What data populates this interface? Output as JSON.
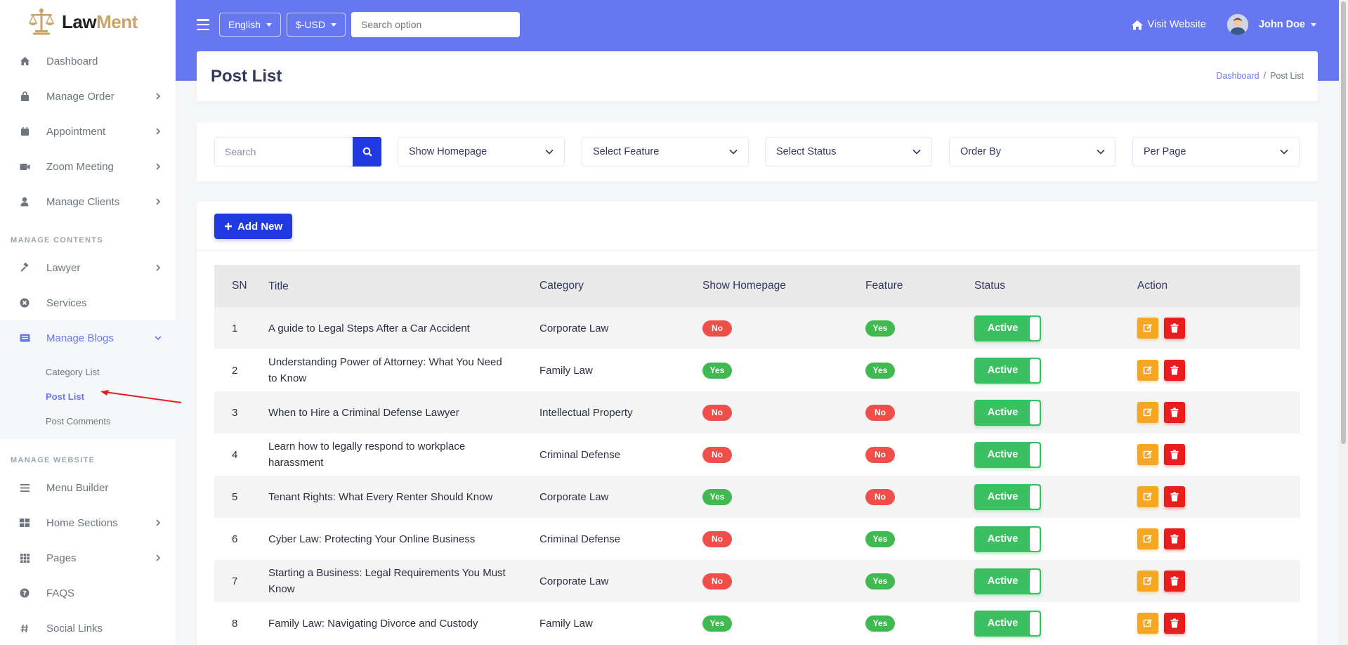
{
  "brand": {
    "name_part1": "Law",
    "name_part2": "Ment",
    "accent": "#c7a56a"
  },
  "colors": {
    "primary": "#6777ef",
    "button": "#2039e0",
    "yes": "#3fb950",
    "no": "#f04e4a",
    "active": "#3ac060",
    "edit": "#f5a623",
    "delete": "#ea1d1d"
  },
  "sidebar": {
    "items_top": [
      {
        "label": "Dashboard",
        "icon": "home-icon"
      },
      {
        "label": "Manage Order",
        "icon": "bag-icon"
      },
      {
        "label": "Appointment",
        "icon": "calendar-icon"
      },
      {
        "label": "Zoom Meeting",
        "icon": "video-icon"
      },
      {
        "label": "Manage Clients",
        "icon": "user-icon"
      }
    ],
    "section_contents": "MANAGE CONTENTS",
    "items_contents": [
      {
        "label": "Lawyer",
        "icon": "gavel-icon"
      },
      {
        "label": "Services",
        "icon": "cog-circle-icon"
      },
      {
        "label": "Manage Blogs",
        "icon": "newspaper-icon"
      }
    ],
    "blog_submenu": [
      "Category List",
      "Post List",
      "Post Comments"
    ],
    "section_website": "MANAGE WEBSITE",
    "items_website": [
      {
        "label": "Menu Builder",
        "icon": "bars-icon"
      },
      {
        "label": "Home Sections",
        "icon": "grid-icon"
      },
      {
        "label": "Pages",
        "icon": "pages-grid-icon"
      },
      {
        "label": "FAQS",
        "icon": "question-icon"
      },
      {
        "label": "Social Links",
        "icon": "hash-icon"
      }
    ]
  },
  "topbar": {
    "language": "English",
    "currency": "$-USD",
    "search_placeholder": "Search option",
    "visit_website": "Visit Website",
    "user_name": "John Doe"
  },
  "header": {
    "title": "Post List",
    "breadcrumb_home": "Dashboard",
    "breadcrumb_sep": "/",
    "breadcrumb_current": "Post List"
  },
  "filters": {
    "search_placeholder": "Search",
    "show_homepage": "Show Homepage",
    "select_feature": "Select Feature",
    "select_status": "Select Status",
    "order_by": "Order By",
    "per_page": "Per Page"
  },
  "table": {
    "add_new": "Add New",
    "columns": [
      "SN",
      "Title",
      "Category",
      "Show Homepage",
      "Feature",
      "Status",
      "Action"
    ],
    "rows": [
      {
        "sn": "1",
        "title": "A guide to Legal Steps After a Car Accident",
        "category": "Corporate Law",
        "homepage": "No",
        "feature": "Yes",
        "status": "Active"
      },
      {
        "sn": "2",
        "title": "Understanding Power of Attorney: What You Need to Know",
        "category": "Family Law",
        "homepage": "Yes",
        "feature": "Yes",
        "status": "Active"
      },
      {
        "sn": "3",
        "title": "When to Hire a Criminal Defense Lawyer",
        "category": "Intellectual Property",
        "homepage": "No",
        "feature": "No",
        "status": "Active"
      },
      {
        "sn": "4",
        "title": "Learn how to legally respond to workplace harassment",
        "category": "Criminal Defense",
        "homepage": "No",
        "feature": "No",
        "status": "Active"
      },
      {
        "sn": "5",
        "title": "Tenant Rights: What Every Renter Should Know",
        "category": "Corporate Law",
        "homepage": "Yes",
        "feature": "No",
        "status": "Active"
      },
      {
        "sn": "6",
        "title": "Cyber Law: Protecting Your Online Business",
        "category": "Criminal Defense",
        "homepage": "No",
        "feature": "Yes",
        "status": "Active"
      },
      {
        "sn": "7",
        "title": "Starting a Business: Legal Requirements You Must Know",
        "category": "Corporate Law",
        "homepage": "No",
        "feature": "Yes",
        "status": "Active"
      },
      {
        "sn": "8",
        "title": "Family Law: Navigating Divorce and Custody",
        "category": "Family Law",
        "homepage": "Yes",
        "feature": "Yes",
        "status": "Active"
      }
    ]
  }
}
